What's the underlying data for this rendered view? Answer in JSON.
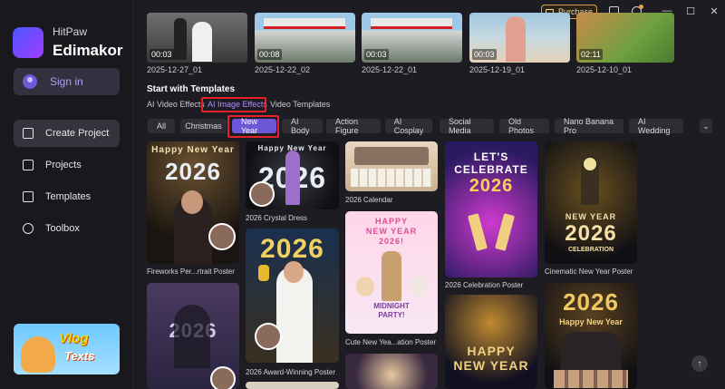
{
  "app": {
    "brand_top": "HitPaw",
    "brand_bottom": "Edimakor"
  },
  "sidebar": {
    "signin": "Sign in",
    "items": [
      {
        "label": "Create Project",
        "icon": "plus-icon"
      },
      {
        "label": "Projects",
        "icon": "folder-icon"
      },
      {
        "label": "Templates",
        "icon": "template-icon"
      },
      {
        "label": "Toolbox",
        "icon": "toolbox-icon"
      }
    ],
    "banner": {
      "line1": "Vlog",
      "line2": "Texts"
    }
  },
  "topbar": {
    "purchase": "Purchase"
  },
  "recent": [
    {
      "duration": "00:03",
      "name": "2025-12-27_01"
    },
    {
      "duration": "00:08",
      "name": "2025-12-22_02"
    },
    {
      "duration": "00:03",
      "name": "2025-12-22_01"
    },
    {
      "duration": "00:03",
      "name": "2025-12-19_01"
    },
    {
      "duration": "02:11",
      "name": "2025-12-10_01"
    }
  ],
  "templates": {
    "title": "Start with Templates",
    "tabs": [
      "AI Video Effects",
      "AI Image Effects",
      "Video Templates"
    ],
    "active_tab": "AI Image Effects",
    "chips": [
      "All",
      "Christmas",
      "New Year",
      "AI Body",
      "Action Figure",
      "AI Cosplay",
      "Social Media",
      "Old Photos",
      "Nano Banana Pro",
      "AI Wedding"
    ],
    "active_chip": "New Year",
    "cards": [
      {
        "caption": "Fireworks Per...rtrait Poster",
        "art": "Happy New Year 2026"
      },
      {
        "caption": "2026 Crystal Dress",
        "art": "Happy New Year 2026"
      },
      {
        "caption": "2026 Calendar",
        "art": ""
      },
      {
        "caption": "2026 Celebration Poster",
        "art": "LET'S CELEBRATE 2026"
      },
      {
        "caption": "Cinematic New Year Poster",
        "art": "NEW YEAR 2026 CELEBRATION"
      },
      {
        "caption": "",
        "art": "2026"
      },
      {
        "caption": "2026 Award-Winning Poster",
        "art": "2026"
      },
      {
        "caption": "Cute New Yea...ation Poster",
        "art": "HAPPY NEW YEAR 2026! MIDNIGHT PARTY!"
      },
      {
        "caption": "",
        "art": "HAPPY NEW YEAR"
      },
      {
        "caption": "",
        "art": "2026 Happy New Year"
      }
    ]
  },
  "colors": {
    "accent": "#6d57d9",
    "highlight": "#e8202a",
    "purchase_border": "#d8a24a"
  }
}
